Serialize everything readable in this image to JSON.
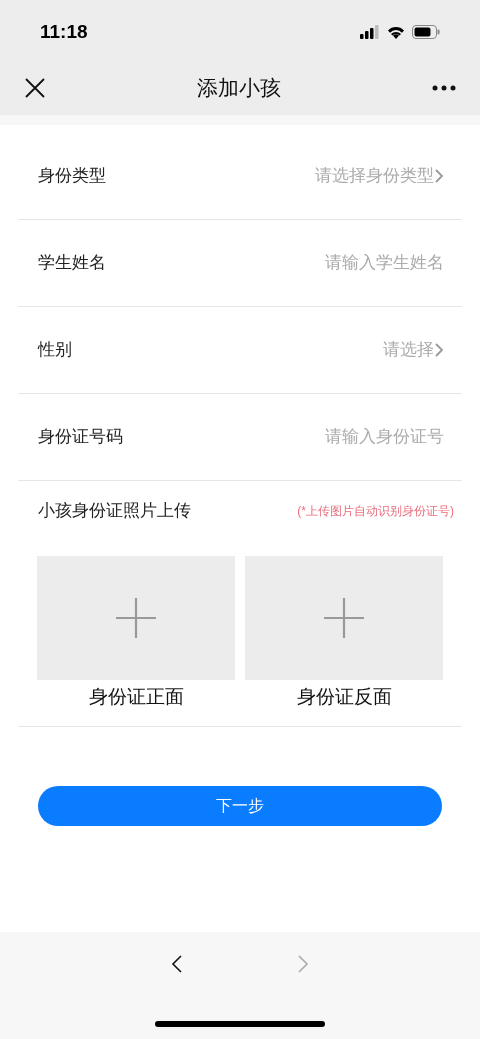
{
  "status_bar": {
    "time": "11:18"
  },
  "nav": {
    "title": "添加小孩"
  },
  "fields": [
    {
      "kind": "select",
      "label": "身份类型",
      "placeholder": "请选择身份类型"
    },
    {
      "kind": "input",
      "label": "学生姓名",
      "placeholder": "请输入学生姓名"
    },
    {
      "kind": "select",
      "label": "性别",
      "placeholder": "请选择"
    },
    {
      "kind": "input",
      "label": "身份证号码",
      "placeholder": "请输入身份证号"
    }
  ],
  "upload": {
    "label": "小孩身份证照片上传",
    "hint": "(*上传图片自动识别身份证号)",
    "slots": [
      {
        "caption": "身份证正面"
      },
      {
        "caption": "身份证反面"
      }
    ]
  },
  "next_button": "下一步",
  "browser_bar": {
    "back_disabled": false,
    "forward_disabled": true
  }
}
